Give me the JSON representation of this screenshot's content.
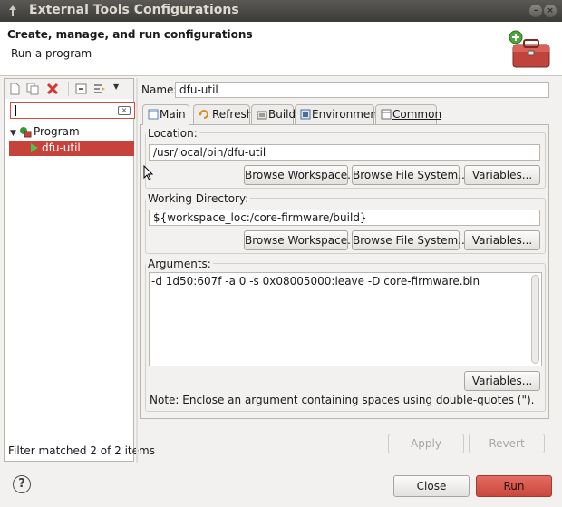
{
  "window": {
    "title": "External Tools Configurations"
  },
  "banner": {
    "heading": "Create, manage, and run configurations",
    "subheading": "Run a program",
    "icon": "toolbox-icon"
  },
  "left_panel": {
    "toolbar_icons": [
      "new-config-icon",
      "duplicate-config-icon",
      "delete-config-icon",
      "collapse-all-icon",
      "filter-config-icon",
      "view-menu-icon"
    ],
    "filter": {
      "value": "",
      "placeholder": ""
    },
    "tree": {
      "category": "Program",
      "items": [
        "dfu-util"
      ],
      "selected": "dfu-util"
    },
    "status": "Filter matched 2 of 2 items"
  },
  "config": {
    "name_label": "Name:",
    "name_value": "dfu-util",
    "tabs": [
      {
        "label": "Main",
        "icon": "main-tab-icon",
        "active": true
      },
      {
        "label": "Refresh",
        "icon": "refresh-icon",
        "active": false
      },
      {
        "label": "Build",
        "icon": "build-icon",
        "active": false
      },
      {
        "label": "Environment",
        "icon": "environment-icon",
        "active": false
      },
      {
        "label": "Common",
        "icon": "common-icon",
        "active": false
      }
    ],
    "location": {
      "label": "Location:",
      "value": "/usr/local/bin/dfu-util",
      "browse_workspace": "Browse Workspace...",
      "browse_fs": "Browse File System...",
      "variables": "Variables..."
    },
    "working_dir": {
      "label": "Working Directory:",
      "value": "${workspace_loc:/core-firmware/build}",
      "browse_workspace": "Browse Workspace...",
      "browse_fs": "Browse File System...",
      "variables": "Variables..."
    },
    "arguments": {
      "label": "Arguments:",
      "value": "-d 1d50:607f -a 0 -s 0x08005000:leave -D core-firmware.bin",
      "variables": "Variables...",
      "note": "Note: Enclose an argument containing spaces using double-quotes (\")."
    },
    "apply_label": "Apply",
    "revert_label": "Revert"
  },
  "footer": {
    "help_symbol": "?",
    "close_label": "Close",
    "run_label": "Run"
  },
  "colors": {
    "selection": "#c7423a",
    "titlebar": "#3c3b37",
    "run_button": "#d6574c"
  }
}
